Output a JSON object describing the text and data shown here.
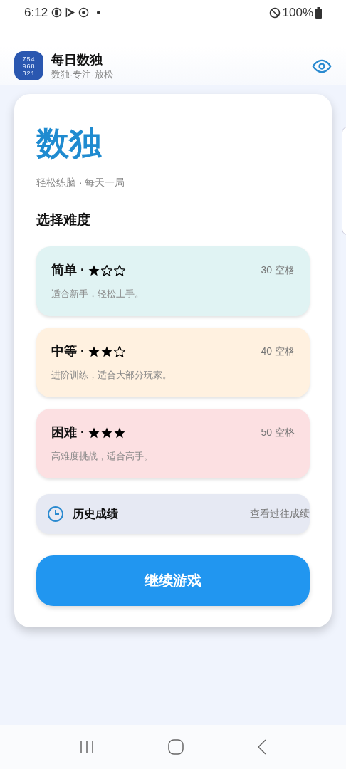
{
  "status_bar": {
    "time": "6:12",
    "battery": "100%"
  },
  "header": {
    "app_name": "每日数独",
    "tagline": "数独·专注·放松",
    "icon_digits": [
      "754",
      "968",
      "321"
    ]
  },
  "card": {
    "title": "数独",
    "subtitle": "轻松练脑 · 每天一局",
    "section_title": "选择难度",
    "levels": [
      {
        "name": "简单 ·",
        "stars": 1,
        "blanks": "30 空格",
        "description": "适合新手，轻松上手。",
        "color": "#e0f3f3"
      },
      {
        "name": "中等 ·",
        "stars": 2,
        "blanks": "40 空格",
        "description": "进阶训练，适合大部分玩家。",
        "color": "#fff1e0"
      },
      {
        "name": "困难 ·",
        "stars": 3,
        "blanks": "50 空格",
        "description": "高难度挑战，适合高手。",
        "color": "#fce0e2"
      }
    ],
    "history": {
      "label": "历史成绩",
      "action": "查看过往成绩"
    },
    "continue_button": "继续游戏"
  }
}
